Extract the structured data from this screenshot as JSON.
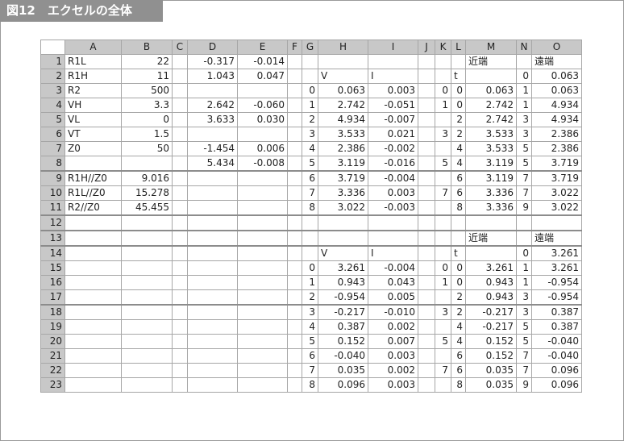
{
  "figure": {
    "title": "図12　エクセルの全体"
  },
  "sheet": {
    "columns": [
      "A",
      "B",
      "C",
      "D",
      "E",
      "F",
      "G",
      "H",
      "I",
      "J",
      "K",
      "L",
      "M",
      "N",
      "O"
    ],
    "rows": [
      [
        "1",
        "R1L",
        "22",
        "",
        "-0.317",
        "-0.014",
        "",
        "",
        "",
        "",
        "",
        "",
        "",
        "近端",
        "",
        "遠端"
      ],
      [
        "2",
        "R1H",
        "11",
        "",
        "1.043",
        "0.047",
        "",
        "",
        "V",
        "I",
        "",
        "",
        "t",
        "",
        "0",
        "0.063"
      ],
      [
        "3",
        "R2",
        "500",
        "",
        "",
        "",
        "",
        "0",
        "0.063",
        "0.003",
        "",
        "0",
        "0",
        "0.063",
        "1",
        "0.063"
      ],
      [
        "4",
        "VH",
        "3.3",
        "",
        "2.642",
        "-0.060",
        "",
        "1",
        "2.742",
        "-0.051",
        "",
        "1",
        "0",
        "2.742",
        "1",
        "4.934"
      ],
      [
        "5",
        "VL",
        "0",
        "",
        "3.633",
        "0.030",
        "",
        "2",
        "4.934",
        "-0.007",
        "",
        "",
        "2",
        "2.742",
        "3",
        "4.934"
      ],
      [
        "6",
        "VT",
        "1.5",
        "",
        "",
        "",
        "",
        "3",
        "3.533",
        "0.021",
        "",
        "3",
        "2",
        "3.533",
        "3",
        "2.386"
      ],
      [
        "7",
        "Z0",
        "50",
        "",
        "-1.454",
        "0.006",
        "",
        "4",
        "2.386",
        "-0.002",
        "",
        "",
        "4",
        "3.533",
        "5",
        "2.386"
      ],
      [
        "8",
        "",
        "",
        "",
        "5.434",
        "-0.008",
        "",
        "5",
        "3.119",
        "-0.016",
        "",
        "5",
        "4",
        "3.119",
        "5",
        "3.719"
      ],
      [
        "9",
        "R1H//Z0",
        "9.016",
        "",
        "",
        "",
        "",
        "6",
        "3.719",
        "-0.004",
        "",
        "",
        "6",
        "3.119",
        "7",
        "3.719"
      ],
      [
        "10",
        "R1L//Z0",
        "15.278",
        "",
        "",
        "",
        "",
        "7",
        "3.336",
        "0.003",
        "",
        "7",
        "6",
        "3.336",
        "7",
        "3.022"
      ],
      [
        "11",
        "R2//Z0",
        "45.455",
        "",
        "",
        "",
        "",
        "8",
        "3.022",
        "-0.003",
        "",
        "",
        "8",
        "3.336",
        "9",
        "3.022"
      ],
      [
        "12",
        "",
        "",
        "",
        "",
        "",
        "",
        "",
        "",
        "",
        "",
        "",
        "",
        "",
        "",
        ""
      ],
      [
        "13",
        "",
        "",
        "",
        "",
        "",
        "",
        "",
        "",
        "",
        "",
        "",
        "",
        "近端",
        "",
        "遠端"
      ],
      [
        "14",
        "",
        "",
        "",
        "",
        "",
        "",
        "",
        "V",
        "I",
        "",
        "",
        "t",
        "",
        "0",
        "3.261"
      ],
      [
        "15",
        "",
        "",
        "",
        "",
        "",
        "",
        "0",
        "3.261",
        "-0.004",
        "",
        "0",
        "0",
        "3.261",
        "1",
        "3.261"
      ],
      [
        "16",
        "",
        "",
        "",
        "",
        "",
        "",
        "1",
        "0.943",
        "0.043",
        "",
        "1",
        "0",
        "0.943",
        "1",
        "-0.954"
      ],
      [
        "17",
        "",
        "",
        "",
        "",
        "",
        "",
        "2",
        "-0.954",
        "0.005",
        "",
        "",
        "2",
        "0.943",
        "3",
        "-0.954"
      ],
      [
        "18",
        "",
        "",
        "",
        "",
        "",
        "",
        "3",
        "-0.217",
        "-0.010",
        "",
        "3",
        "2",
        "-0.217",
        "3",
        "0.387"
      ],
      [
        "19",
        "",
        "",
        "",
        "",
        "",
        "",
        "4",
        "0.387",
        "0.002",
        "",
        "",
        "4",
        "-0.217",
        "5",
        "0.387"
      ],
      [
        "20",
        "",
        "",
        "",
        "",
        "",
        "",
        "5",
        "0.152",
        "0.007",
        "",
        "5",
        "4",
        "0.152",
        "5",
        "-0.040"
      ],
      [
        "21",
        "",
        "",
        "",
        "",
        "",
        "",
        "6",
        "-0.040",
        "0.003",
        "",
        "",
        "6",
        "0.152",
        "7",
        "-0.040"
      ],
      [
        "22",
        "",
        "",
        "",
        "",
        "",
        "",
        "7",
        "0.035",
        "0.002",
        "",
        "7",
        "6",
        "0.035",
        "7",
        "0.096"
      ],
      [
        "23",
        "",
        "",
        "",
        "",
        "",
        "",
        "8",
        "0.096",
        "0.003",
        "",
        "",
        "8",
        "0.035",
        "9",
        "0.096"
      ]
    ]
  }
}
